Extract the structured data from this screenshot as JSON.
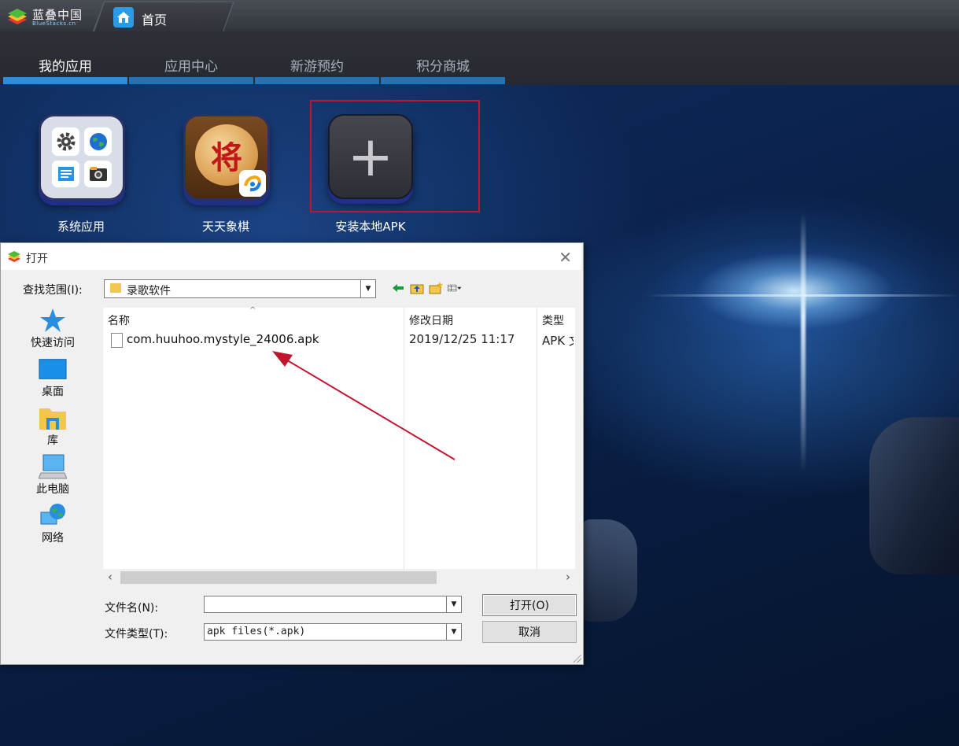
{
  "titlebar": {
    "brand": "蓝叠中国",
    "brand_sub": "BlueStacks.cn",
    "home_tab": "首页"
  },
  "nav": {
    "tabs": [
      {
        "label": "我的应用",
        "active": true
      },
      {
        "label": "应用中心",
        "active": false
      },
      {
        "label": "新游预约",
        "active": false
      },
      {
        "label": "积分商城",
        "active": false
      }
    ]
  },
  "apps": [
    {
      "label": "系统应用",
      "icon": "system-apps-icon"
    },
    {
      "label": "天天象棋",
      "icon": "chinese-chess-icon",
      "glyph": "将"
    },
    {
      "label": "安装本地APK",
      "icon": "plus-icon"
    }
  ],
  "dialog": {
    "title": "打开",
    "look_in_label": "查找范围(I):",
    "look_in_value": "录歌软件",
    "places": [
      {
        "label": "快速访问",
        "icon": "star-icon"
      },
      {
        "label": "桌面",
        "icon": "desktop-icon"
      },
      {
        "label": "库",
        "icon": "library-folder-icon"
      },
      {
        "label": "此电脑",
        "icon": "computer-icon"
      },
      {
        "label": "网络",
        "icon": "network-icon"
      }
    ],
    "columns": {
      "name": "名称",
      "date": "修改日期",
      "type": "类型"
    },
    "files": [
      {
        "name": "com.huuhoo.mystyle_24006.apk",
        "date": "2019/12/25 11:17",
        "type": "APK 文"
      }
    ],
    "filename_label": "文件名(N):",
    "filename_value": "",
    "filetype_label": "文件类型(T):",
    "filetype_value": "apk files(*.apk)",
    "open_button": "打开(O)",
    "cancel_button": "取消"
  },
  "colors": {
    "accent_blue": "#2a8ee0",
    "highlight_red": "#c3142e"
  }
}
